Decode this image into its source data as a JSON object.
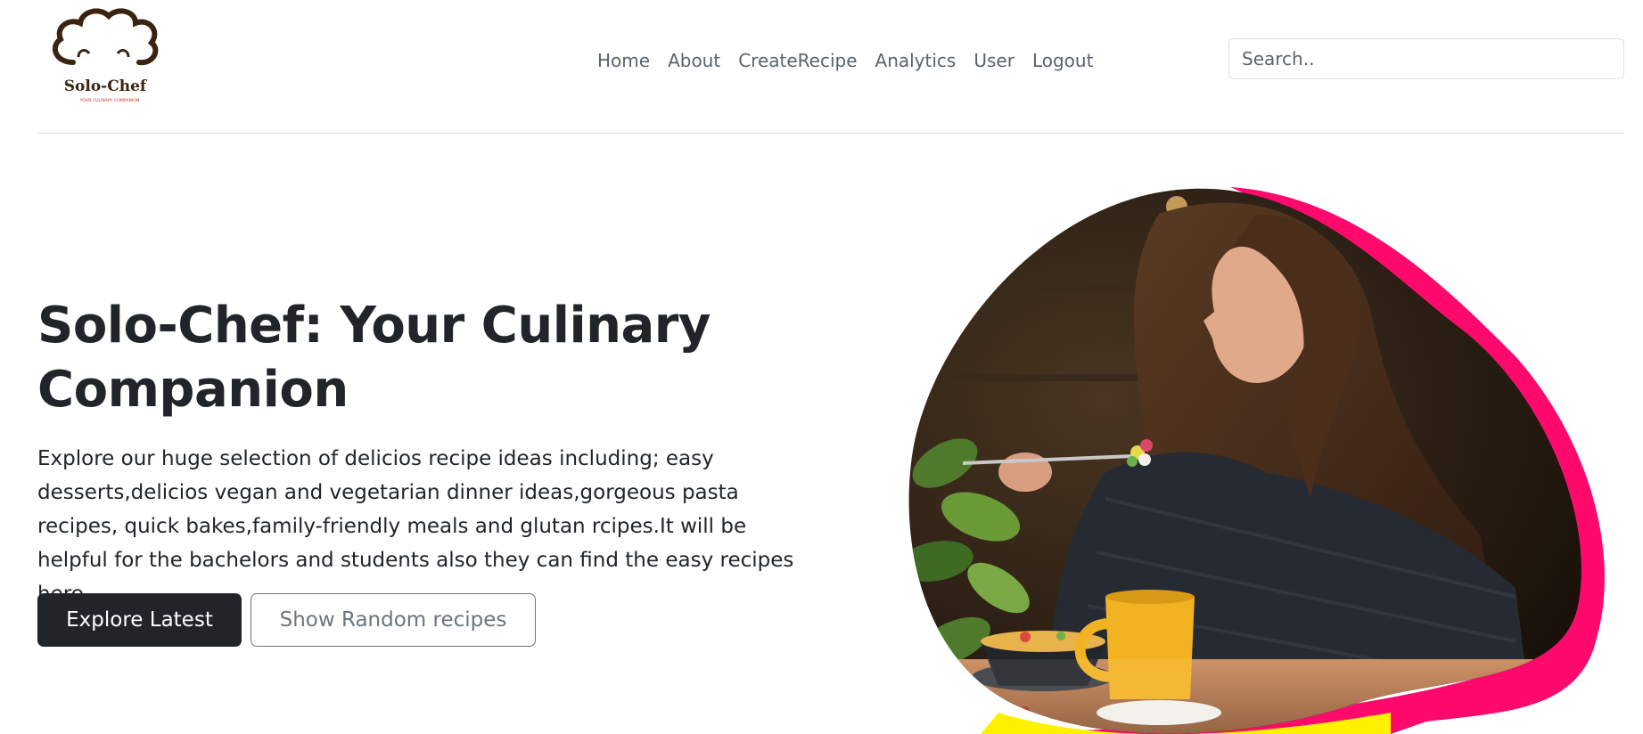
{
  "logo": {
    "name": "Solo-Chef",
    "tagline": "YOUR CULINARY COMPANION"
  },
  "nav": {
    "items": [
      "Home",
      "About",
      "CreateRecipe",
      "Analytics",
      "User",
      "Logout"
    ]
  },
  "search": {
    "placeholder": "Search.."
  },
  "hero": {
    "title": "Solo-Chef: Your Culinary Companion",
    "description": "Explore our huge selection of delicios recipe ideas including; easy desserts,delicios vegan and vegetarian dinner ideas,gorgeous pasta recipes, quick bakes,family-friendly meals and glutan rcipes.It will be helpful for the bachelors and students also they can find the easy recipes here..",
    "primary_button": "Explore Latest",
    "secondary_button": "Show Random recipes",
    "accent_colors": [
      "#ff0a6c",
      "#fff200"
    ]
  }
}
